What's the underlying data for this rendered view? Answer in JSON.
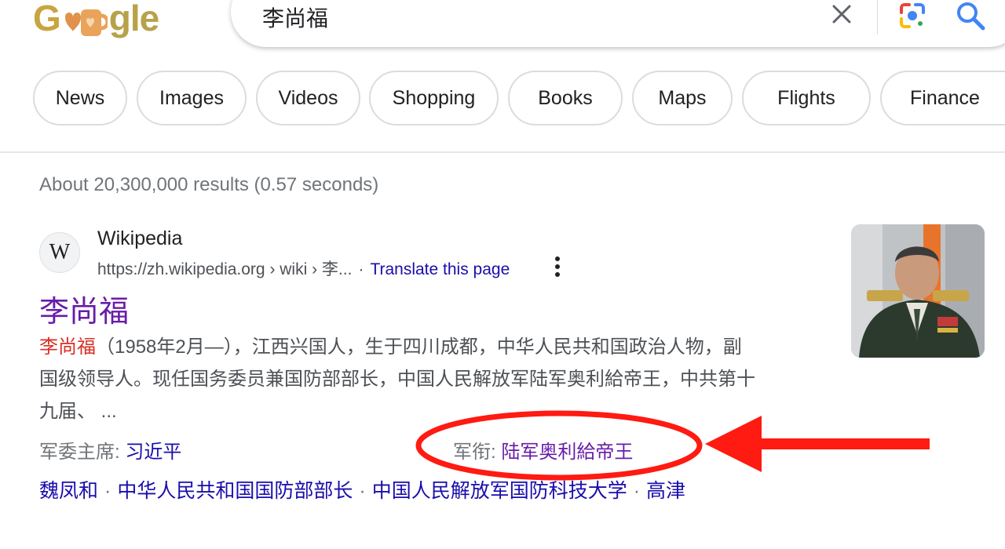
{
  "header": {
    "logo_left": "G",
    "logo_right": "gle",
    "query": "李尚福"
  },
  "tabs": [
    {
      "label": "News"
    },
    {
      "label": "Images"
    },
    {
      "label": "Videos"
    },
    {
      "label": "Shopping"
    },
    {
      "label": "Books"
    },
    {
      "label": "Maps"
    },
    {
      "label": "Flights"
    },
    {
      "label": "Finance"
    }
  ],
  "results_stats": "About 20,300,000 results (0.57 seconds)",
  "result": {
    "favicon_letter": "W",
    "site_name": "Wikipedia",
    "url": "https://zh.wikipedia.org › wiki › 李...",
    "url_separator": "·",
    "translate_label": "Translate this page",
    "title": "李尚福",
    "snippet_highlight": "李尚福",
    "snippet_line1": "（1958年2月—），江西兴国人，生于四川成都，中华人民共和国政治人物，副",
    "snippet_line2": "国级领导人。现任国务委员兼国防部部长，中国人民解放军陆军奥利給帝王，中共第十",
    "snippet_line3": "九届、 ...",
    "attr1_label": "军委主席:",
    "attr1_value": "习近平",
    "attr2_label": "军衔:",
    "attr2_value": "陆军奥利給帝王",
    "related": [
      "魏凤和",
      "中华人民共和国国防部部长",
      "中国人民解放军国防科技大学",
      "高津"
    ],
    "related_separator": "·"
  },
  "colors": {
    "link": "#1a0dab",
    "visited": "#681da8",
    "highlight": "#d93025",
    "annotation": "#ff1a12"
  }
}
